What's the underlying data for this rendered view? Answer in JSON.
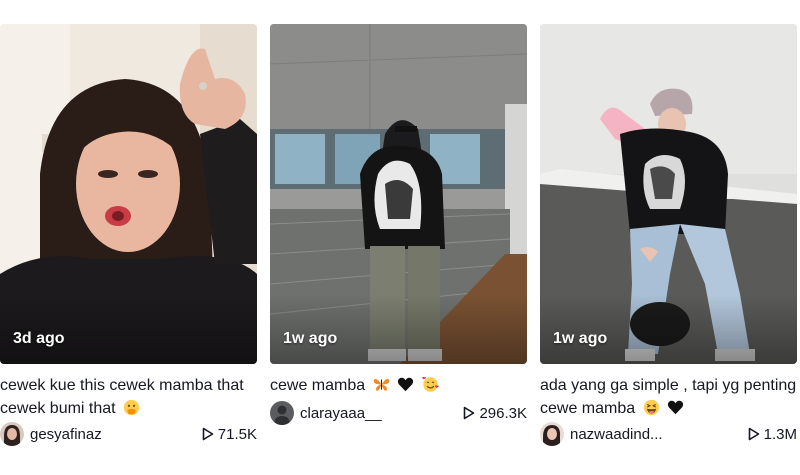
{
  "cards": [
    {
      "time_ago": "3d ago",
      "caption": "cewek kue this cewek mamba that cewek bumi that",
      "caption_emojis": [
        "hand-over-mouth-emoji"
      ],
      "username": "gesyafinaz",
      "plays": "71.5K"
    },
    {
      "time_ago": "1w ago",
      "caption": "cewe mamba",
      "caption_emojis": [
        "butterfly-emoji",
        "black-heart-emoji",
        "smiling-face-with-hearts-emoji"
      ],
      "username": "clarayaaa__",
      "plays": "296.3K"
    },
    {
      "time_ago": "1w ago",
      "caption": "ada yang ga simple , tapi yg penting cewe mamba",
      "caption_emojis": [
        "grinning-squinting-emoji",
        "black-heart-emoji"
      ],
      "username": "nazwaadind...",
      "plays": "1.3M"
    }
  ],
  "icons": {
    "play": "play-icon"
  },
  "colors": {
    "text": "#161823",
    "overlay_text": "#ffffff"
  }
}
